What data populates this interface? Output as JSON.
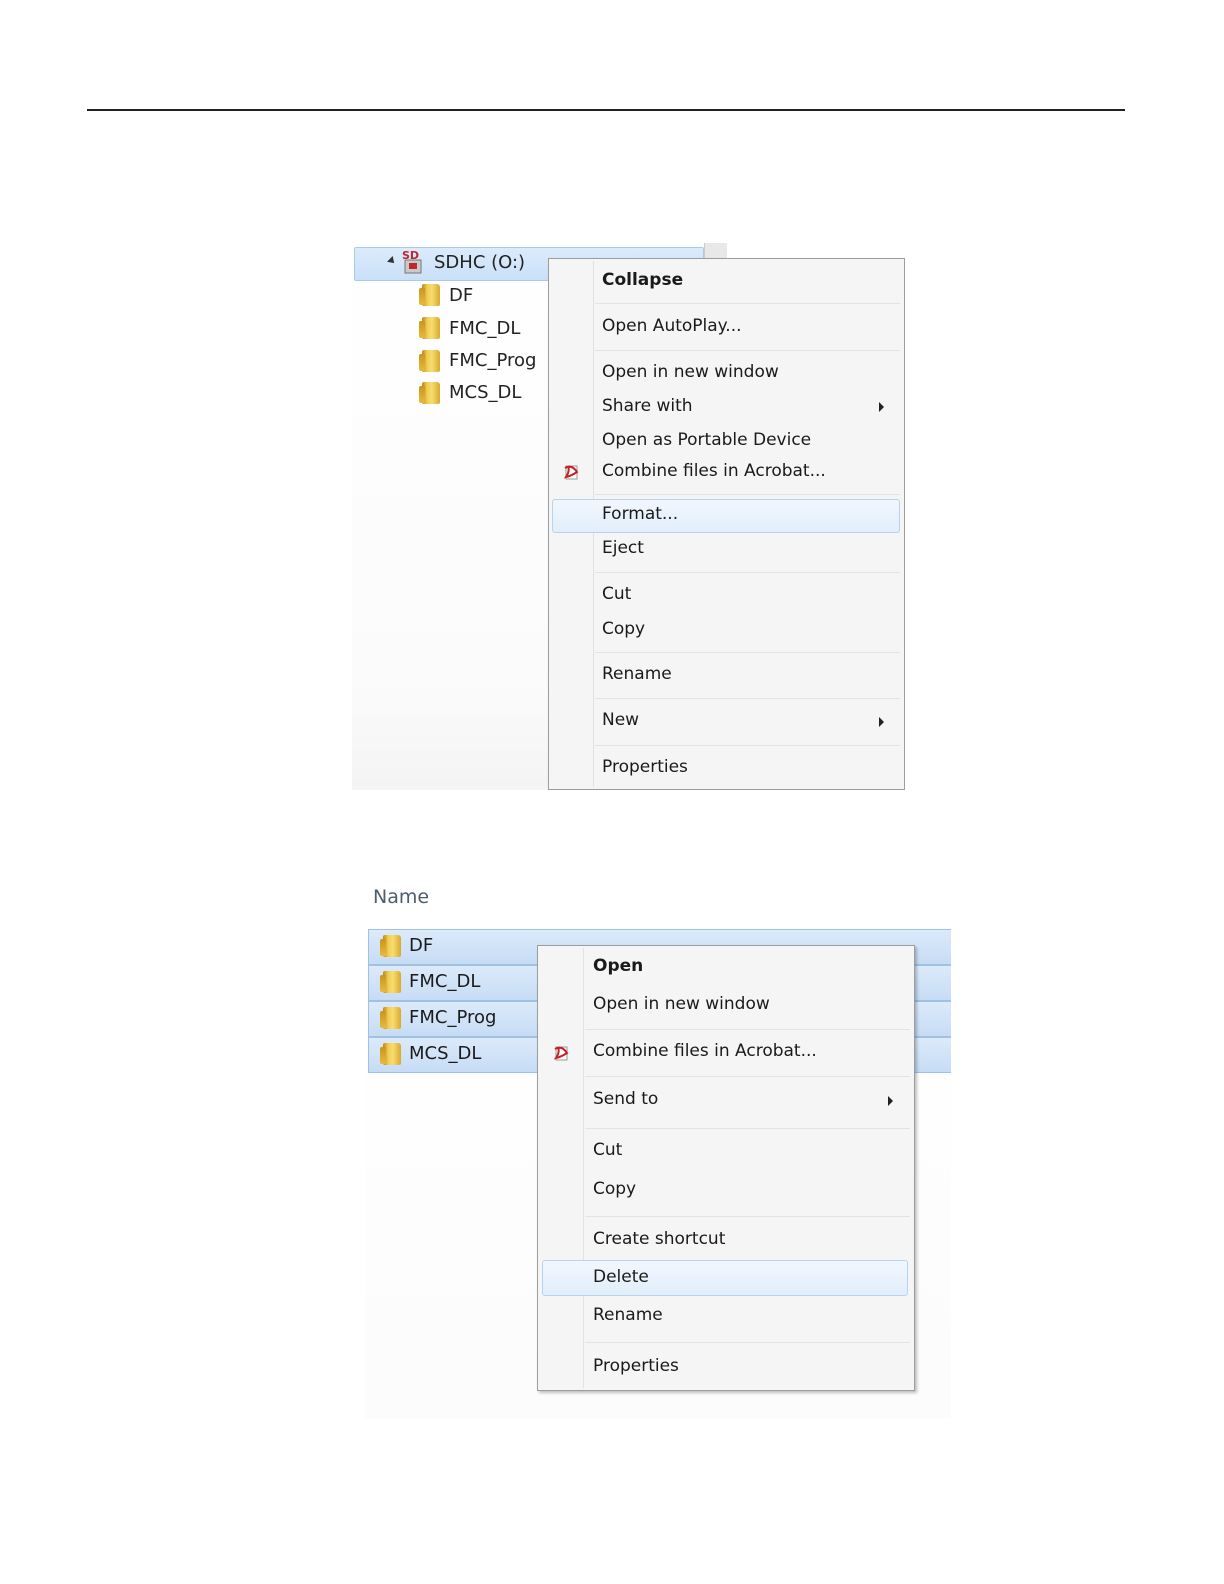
{
  "screenshot1": {
    "tree": {
      "drive_label": "SDHC (O:)",
      "folders": [
        "DF",
        "FMC_DL",
        "FMC_Prog",
        "MCS_DL"
      ]
    },
    "context_menu": {
      "items": [
        {
          "label": "Collapse"
        },
        {
          "label": "Open AutoPlay..."
        },
        {
          "label": "Open in new window"
        },
        {
          "label": "Share with"
        },
        {
          "label": "Open as Portable Device"
        },
        {
          "label": "Combine files in Acrobat..."
        },
        {
          "label": "Format..."
        },
        {
          "label": "Eject"
        },
        {
          "label": "Cut"
        },
        {
          "label": "Copy"
        },
        {
          "label": "Rename"
        },
        {
          "label": "New"
        },
        {
          "label": "Properties"
        }
      ]
    }
  },
  "screenshot2": {
    "column_header": "Name",
    "files": [
      "DF",
      "FMC_DL",
      "FMC_Prog",
      "MCS_DL"
    ],
    "context_menu": {
      "items": [
        {
          "label": "Open"
        },
        {
          "label": "Open in new window"
        },
        {
          "label": "Combine files in Acrobat..."
        },
        {
          "label": "Send to"
        },
        {
          "label": "Cut"
        },
        {
          "label": "Copy"
        },
        {
          "label": "Create shortcut"
        },
        {
          "label": "Delete"
        },
        {
          "label": "Rename"
        },
        {
          "label": "Properties"
        }
      ]
    }
  },
  "colors": {
    "selection": "#cfe3f9",
    "menu_bg": "#f5f5f5",
    "menu_border": "#9d9d9d"
  }
}
